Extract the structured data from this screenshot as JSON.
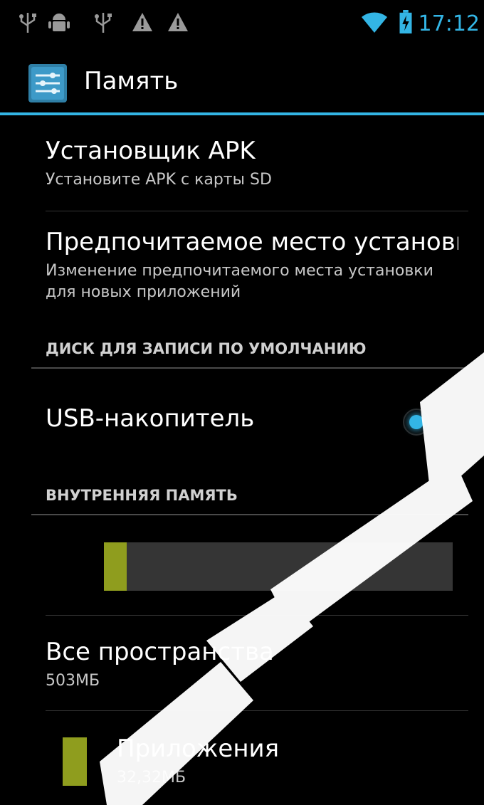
{
  "status_bar": {
    "icons": [
      "usb-icon",
      "android-debug-icon",
      "usb-icon",
      "warning-icon",
      "warning-icon",
      "wifi-icon",
      "battery-charging-icon"
    ],
    "time": "17:12"
  },
  "action_bar": {
    "title": "Память",
    "icon": "settings-sliders-icon"
  },
  "prefs": {
    "apk_installer": {
      "title": "Установщик APK",
      "summary": "Установите APK с карты SD"
    },
    "install_location": {
      "title": "Предпочитаемое место установки",
      "summary": "Изменение предпочитаемого места установки для новых приложений"
    }
  },
  "categories": {
    "default_disk": "ДИСК ДЛЯ ЗАПИСИ ПО УМОЛЧАНИЮ",
    "internal_storage": "ВНУТРЕННЯЯ ПАМЯТЬ"
  },
  "usb_storage": {
    "label": "USB-накопитель",
    "selected": true
  },
  "storage": {
    "used_fraction": 0.065,
    "total": {
      "title": "Все пространства",
      "value": "503МБ"
    },
    "apps": {
      "title": "Приложения",
      "value": "32,32МБ"
    }
  },
  "colors": {
    "accent": "#33b5e5",
    "apps": "#8f9d1e"
  }
}
